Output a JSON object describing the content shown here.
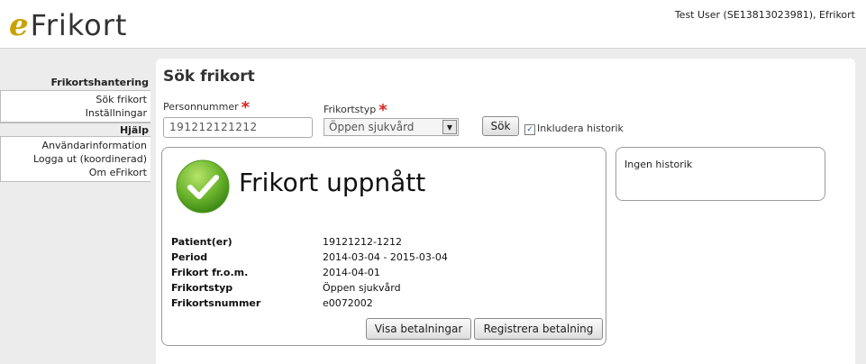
{
  "header": {
    "logo_e": "e",
    "logo_text": "Frikort",
    "user": "Test User (SE13813023981), Efrikort"
  },
  "sidebar": {
    "section1_title": "Frikortshantering",
    "section1_items": [
      {
        "label": "Sök frikort"
      },
      {
        "label": "Inställningar"
      }
    ],
    "section2_title": "Hjälp",
    "section2_items": [
      {
        "label": "Användarinformation"
      },
      {
        "label": "Logga ut (koordinerad)"
      },
      {
        "label": "Om eFrikort"
      }
    ]
  },
  "main": {
    "title": "Sök frikort",
    "personnummer_label": "Personnummer",
    "personnummer_value": "191212121212",
    "frikortstyp_label": "Frikortstyp",
    "frikortstyp_value": "Öppen sjukvård",
    "required_mark": "*",
    "search_button": "Sök",
    "include_history_checked": true,
    "include_history_label": "Inkludera historik"
  },
  "result": {
    "status_icon": "green-check-icon",
    "status": "Frikort uppnått",
    "fields": [
      {
        "key": "Patient(er)",
        "value": "19121212-1212"
      },
      {
        "key": "Period",
        "value": "2014-03-04 - 2015-03-04"
      },
      {
        "key": "Frikort fr.o.m.",
        "value": "2014-04-01"
      },
      {
        "key": "Frikortstyp",
        "value": "Öppen sjukvård"
      },
      {
        "key": "Frikortsnummer",
        "value": "e0072002"
      }
    ],
    "show_payments_button": "Visa betalningar",
    "register_payment_button": "Registrera betalning"
  },
  "history": {
    "text": "Ingen historik"
  },
  "colors": {
    "accent": "#c9a100",
    "required": "#dd2222",
    "check_green": "#6cb52d"
  }
}
